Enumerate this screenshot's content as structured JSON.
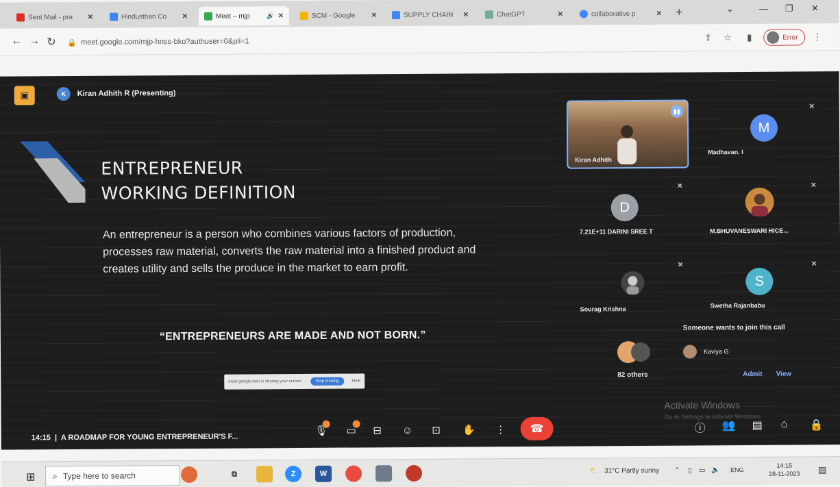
{
  "browser": {
    "tabs": [
      {
        "label": "Sent Mail - pra",
        "favicon_color": "#d93025"
      },
      {
        "label": "Hindusthan Co",
        "favicon_color": "#4285f4"
      },
      {
        "label": "Meet – mjp",
        "favicon_color": "#34a853"
      },
      {
        "label": "SCM - Google",
        "favicon_color": "#f4b400"
      },
      {
        "label": "SUPPLY CHAIN",
        "favicon_color": "#4285f4"
      },
      {
        "label": "ChatGPT",
        "favicon_color": "#74aa9c"
      },
      {
        "label": "collaborative p",
        "favicon_color": "#4285f4"
      }
    ],
    "url": "meet.google.com/mjp-hnss-bko?authuser=0&pli=1",
    "profile_label": "Error"
  },
  "meet": {
    "presenter": "Kiran Adhith R (Presenting)",
    "presenter_initial": "K",
    "slide": {
      "title_line1": "ENTREPRENEUR",
      "title_line2": "WORKING DEFINITION",
      "body": "An entrepreneur is a person who combines various factors of production, processes raw material, converts the raw material into a finished product and creates utility and sells the produce in the market to earn profit.",
      "quote": "“ENTREPRENEURS ARE MADE AND NOT BORN.”",
      "sharebar_text": "meet.google.com is sharing your screen.",
      "sharebar_stop": "Stop sharing",
      "sharebar_hide": "Hide"
    },
    "participants": [
      {
        "name": "Kiran Adhith",
        "initial": ""
      },
      {
        "name": "Madhavan. I",
        "initial": "M",
        "color": "#5b8def"
      },
      {
        "name": "7.21E+11 DARINI SREE T",
        "initial": "D",
        "color": "#9aa0a6"
      },
      {
        "name": "M.BHUVANESWARI HICE...",
        "initial": ""
      },
      {
        "name": "Sourag Krishna",
        "initial": ""
      },
      {
        "name": "Swetha Rajanbabu",
        "initial": "S",
        "color": "#4fb3c9"
      }
    ],
    "others_label": "82 others",
    "join_request": {
      "title": "Someone wants to join this call",
      "name": "Kaviya G",
      "admit": "Admit",
      "view": "View"
    },
    "watermark": "Activate Windows",
    "watermark_sub": "Go to Settings to activate Windows.",
    "time": "14:15",
    "meeting_title": "A ROADMAP FOR YOUNG ENTREPRENEUR'S F..."
  },
  "taskbar": {
    "search_placeholder": "Type here to search",
    "weather": "31°C Partly sunny",
    "lang": "ENG",
    "time": "14:15",
    "date": "28-11-2023"
  }
}
